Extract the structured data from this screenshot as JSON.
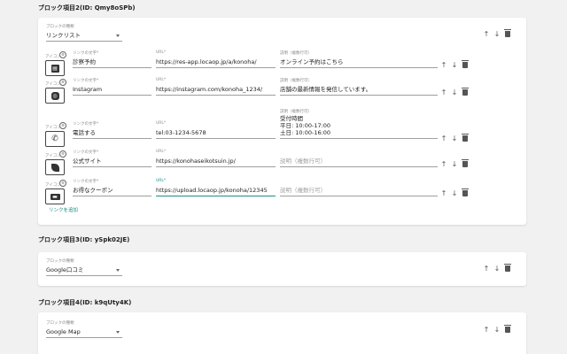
{
  "block2": {
    "title": "ブロック項目2(ID: Qmy8oSPb)",
    "type_label": "ブロックの種類",
    "type_value": "リンクリスト",
    "icon_label": "アイコン",
    "text_label": "リンクの文字*",
    "url_label": "URL*",
    "desc_label": "説明（複数行可）",
    "desc_placeholder": "説明（複数行可）",
    "links": [
      {
        "icon": "calendar-icon",
        "text": "診察予約",
        "url": "https://res-app.locaop.jp/a/konoha/",
        "desc": "オンライン予約はこちら"
      },
      {
        "icon": "instagram-icon",
        "text": "Instagram",
        "url": "https://instagram.com/konoha_1234/",
        "desc": "店舗の最新情報を発信しています。"
      },
      {
        "icon": "phone-icon",
        "text": "電話する",
        "url": "tel:03-1234-5678",
        "desc_lines": [
          "受付時間",
          "平日: 10:00-17:00",
          "土日: 10:00-16:00"
        ]
      },
      {
        "icon": "leaf-icon",
        "text": "公式サイト",
        "url": "https://konohaseikotsuin.jp/",
        "desc": ""
      },
      {
        "icon": "coupon-icon",
        "text": "お得なクーポン",
        "url": "https://upload.locaop.jp/konoha/12345",
        "desc": ""
      }
    ],
    "add_link": "リンクを追加"
  },
  "block3": {
    "title": "ブロック項目3(ID: ySpk02JE)",
    "type_label": "ブロックの種類",
    "type_value": "Google口コミ"
  },
  "block4": {
    "title": "ブロック項目4(ID: k9qUty4K)",
    "type_label": "ブロックの種類",
    "type_value": "Google Map"
  },
  "controls": {
    "up": "↑",
    "down": "↓"
  },
  "colors": {
    "accent": "#1a8f87",
    "background": "#f1f1f1"
  }
}
